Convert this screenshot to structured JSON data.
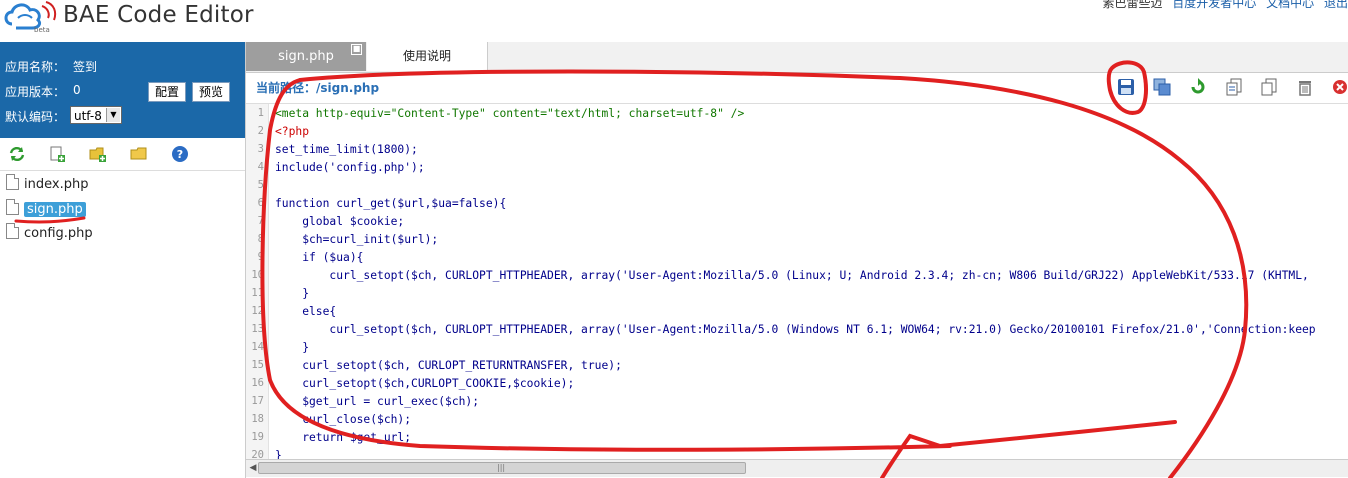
{
  "header": {
    "app_title": "BAE Code Editor",
    "logo_badge": "beta",
    "user_text": "素巴雷些迈",
    "links": [
      "百度开发者中心",
      "文档中心",
      "退出"
    ]
  },
  "app_info": {
    "name_label": "应用名称：",
    "name_value": "签到",
    "version_label": "应用版本：",
    "version_value": "0",
    "encoding_label": "默认编码：",
    "encoding_value": "utf-8",
    "config_button": "配置",
    "preview_button": "预览"
  },
  "file_toolbar": {
    "icons": [
      "refresh-icon",
      "new-file-icon",
      "new-folder-icon",
      "folder-icon",
      "help-icon"
    ]
  },
  "files": [
    {
      "name": "index.php",
      "selected": false
    },
    {
      "name": "sign.php",
      "selected": true
    },
    {
      "name": "config.php",
      "selected": false
    }
  ],
  "tabs": [
    {
      "label": "sign.php",
      "active": true
    },
    {
      "label": "使用说明",
      "active": false
    }
  ],
  "path_bar": {
    "path_text": "当前路径：/sign.php"
  },
  "editor_toolbar": {
    "icons": [
      "save-icon",
      "save-all-icon",
      "refresh-icon",
      "copy-icon",
      "paste-icon",
      "delete-icon",
      "close-icon"
    ]
  },
  "colors": {
    "app_info_bg": "#1b68a8",
    "selected_file_bg": "#3d9fd8",
    "active_tab_bg": "#9e9e9e",
    "annotation_red": "#e02020"
  },
  "code_lines": [
    {
      "n": "1",
      "text": "<meta http-equiv=\"Content-Type\" content=\"text/html; charset=utf-8\" />"
    },
    {
      "n": "2",
      "text": "<?php"
    },
    {
      "n": "3",
      "text": "set_time_limit(1800);"
    },
    {
      "n": "4",
      "text": "include('config.php');"
    },
    {
      "n": "5",
      "text": ""
    },
    {
      "n": "6",
      "text": "function curl_get($url,$ua=false){"
    },
    {
      "n": "7",
      "text": "    global $cookie;"
    },
    {
      "n": "8",
      "text": "    $ch=curl_init($url);"
    },
    {
      "n": "9",
      "text": "    if ($ua){"
    },
    {
      "n": "10",
      "text": "        curl_setopt($ch, CURLOPT_HTTPHEADER, array('User-Agent:Mozilla/5.0 (Linux; U; Android 2.3.4; zh-cn; W806 Build/GRJ22) AppleWebKit/533.17 (KHTML,"
    },
    {
      "n": "11",
      "text": "    }"
    },
    {
      "n": "12",
      "text": "    else{"
    },
    {
      "n": "13",
      "text": "        curl_setopt($ch, CURLOPT_HTTPHEADER, array('User-Agent:Mozilla/5.0 (Windows NT 6.1; WOW64; rv:21.0) Gecko/20100101 Firefox/21.0','Connection:keep"
    },
    {
      "n": "14",
      "text": "    }"
    },
    {
      "n": "15",
      "text": "    curl_setopt($ch, CURLOPT_RETURNTRANSFER, true);"
    },
    {
      "n": "16",
      "text": "    curl_setopt($ch,CURLOPT_COOKIE,$cookie);"
    },
    {
      "n": "17",
      "text": "    $get_url = curl_exec($ch);"
    },
    {
      "n": "18",
      "text": "    curl_close($ch);"
    },
    {
      "n": "19",
      "text": "    return $get_url;"
    },
    {
      "n": "20",
      "text": "}"
    }
  ]
}
